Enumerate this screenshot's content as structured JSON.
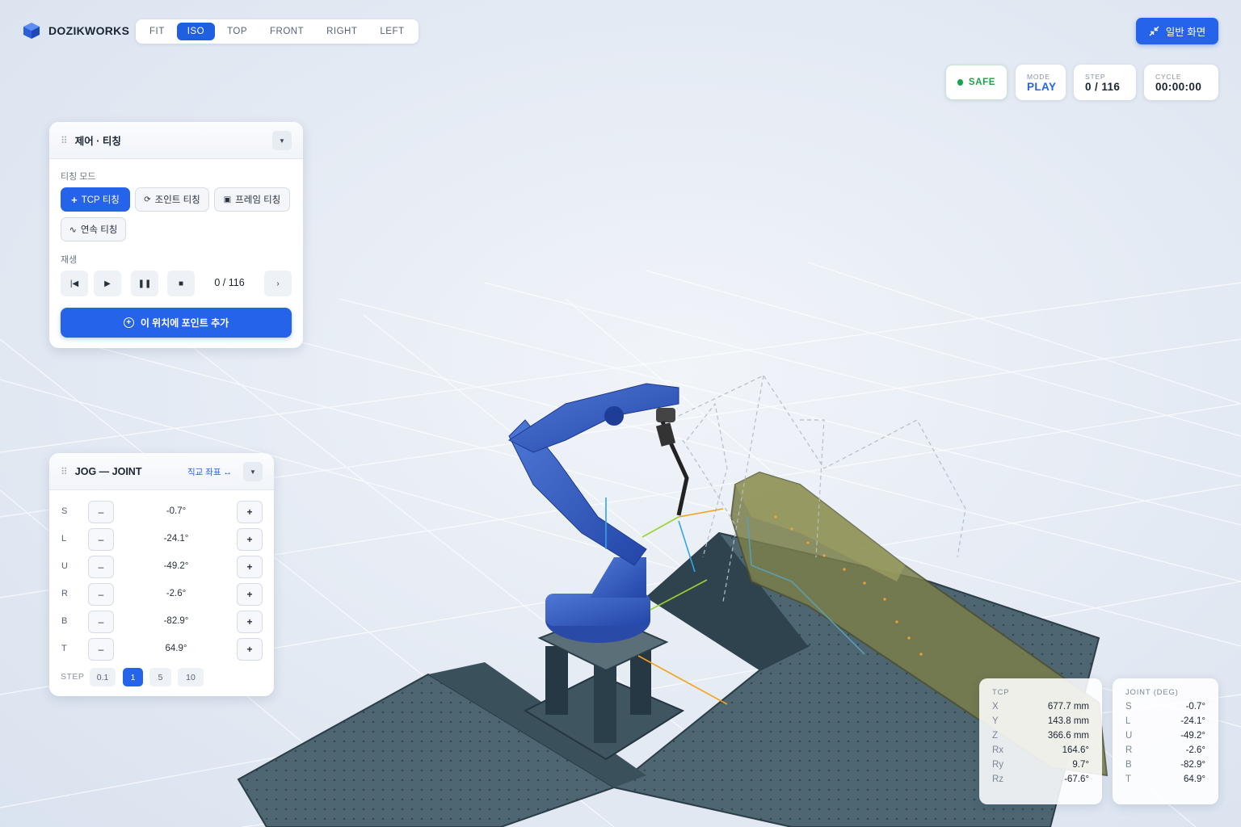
{
  "app": {
    "brand": "DOZIKWORKS"
  },
  "view_tabs": [
    {
      "label": "FIT",
      "active": false
    },
    {
      "label": "ISO",
      "active": true
    },
    {
      "label": "TOP",
      "active": false
    },
    {
      "label": "FRONT",
      "active": false
    },
    {
      "label": "RIGHT",
      "active": false
    },
    {
      "label": "LEFT",
      "active": false
    }
  ],
  "normal_view_button": {
    "label": "일반 화면",
    "icon": "collapse-arrows-icon"
  },
  "status": {
    "safe": {
      "label": "SAFE",
      "color": "#1aa44a"
    },
    "mode": {
      "label": "MODE",
      "value": "PLAY",
      "color": "#2563eb"
    },
    "step": {
      "label": "STEP",
      "value": "0 / 116"
    },
    "cycle": {
      "label": "CYCLE",
      "value": "00:00:00"
    }
  },
  "control_panel": {
    "title": "제어 · 티칭",
    "teach_mode_label": "티칭 모드",
    "teach_modes": [
      {
        "label": "TCP 티칭",
        "icon": "plus-icon",
        "active": true
      },
      {
        "label": "조인트 티칭",
        "icon": "rotate-icon",
        "active": false
      },
      {
        "label": "프레임 티칭",
        "icon": "frame-icon",
        "active": false
      },
      {
        "label": "연속 티칭",
        "icon": "wave-icon",
        "active": false
      }
    ],
    "playback_label": "재생",
    "playback_counter": "0 / 116",
    "add_point_label": "이 위치에 포인트 추가"
  },
  "jog_panel": {
    "title": "JOG — JOINT",
    "switch_label": "직교 좌표 ↔",
    "axes": [
      {
        "axis": "S",
        "value": "-0.7°"
      },
      {
        "axis": "L",
        "value": "-24.1°"
      },
      {
        "axis": "U",
        "value": "-49.2°"
      },
      {
        "axis": "R",
        "value": "-2.6°"
      },
      {
        "axis": "B",
        "value": "-82.9°"
      },
      {
        "axis": "T",
        "value": "64.9°"
      }
    ],
    "step_label": "STEP",
    "steps": [
      {
        "label": "0.1",
        "active": false
      },
      {
        "label": "1",
        "active": true
      },
      {
        "label": "5",
        "active": false
      },
      {
        "label": "10",
        "active": false
      }
    ]
  },
  "tcp_readout": {
    "title": "TCP",
    "rows": [
      {
        "k": "X",
        "v": "677.7 mm"
      },
      {
        "k": "Y",
        "v": "143.8 mm"
      },
      {
        "k": "Z",
        "v": "366.6 mm"
      },
      {
        "k": "Rx",
        "v": "164.6°"
      },
      {
        "k": "Ry",
        "v": "9.7°"
      },
      {
        "k": "Rz",
        "v": "-67.6°"
      }
    ]
  },
  "joint_readout": {
    "title": "JOINT (DEG)",
    "rows": [
      {
        "k": "S",
        "v": "-0.7°"
      },
      {
        "k": "L",
        "v": "-24.1°"
      },
      {
        "k": "U",
        "v": "-49.2°"
      },
      {
        "k": "R",
        "v": "-2.6°"
      },
      {
        "k": "B",
        "v": "-82.9°"
      },
      {
        "k": "T",
        "v": "64.9°"
      }
    ]
  }
}
